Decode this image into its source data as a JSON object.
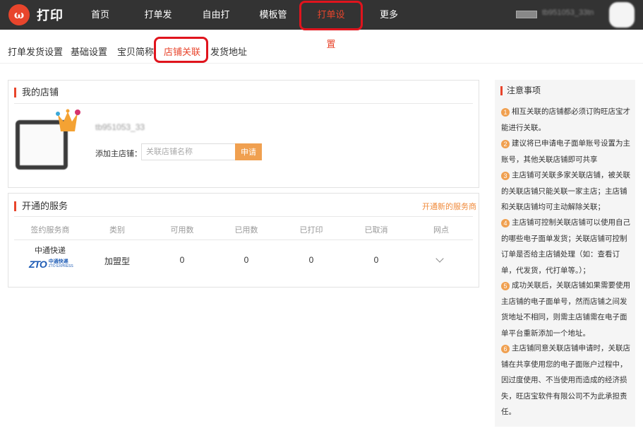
{
  "app": {
    "logo_glyph": "ω",
    "logo_text": "打印"
  },
  "topnav": {
    "items": [
      {
        "label": "首页"
      },
      {
        "label": "打单发货"
      },
      {
        "label": "自由打印"
      },
      {
        "label": "模板管理"
      },
      {
        "label": "打单设置"
      },
      {
        "label": "更多"
      }
    ],
    "active_index": 4,
    "user_name": "tb951053_33tn"
  },
  "subnav": {
    "items": [
      {
        "label": "打单发货设置"
      },
      {
        "label": "基础设置"
      },
      {
        "label": "宝贝简称"
      },
      {
        "label": "店铺关联"
      },
      {
        "label": "发货地址"
      }
    ],
    "active_index": 3
  },
  "my_shop": {
    "title": "我的店铺",
    "shop_id": "tb951053_33",
    "add_label": "添加主店铺：",
    "input_placeholder": "关联店铺名称",
    "apply_button": "申请"
  },
  "services": {
    "title": "开通的服务",
    "open_link": "开通新的服务商",
    "columns": [
      "签约服务商",
      "类别",
      "可用数",
      "已用数",
      "已打印",
      "已取消",
      "网点"
    ],
    "rows": [
      {
        "provider": "中通快递",
        "logo_mark": "ZTO",
        "logo_cn": "中通快递",
        "logo_en": "ZTO EXPRESS",
        "type": "加盟型",
        "available": "0",
        "used": "0",
        "printed": "0",
        "cancelled": "0"
      }
    ]
  },
  "notice": {
    "title": "注意事项",
    "items": [
      {
        "num": "1",
        "text": "相互关联的店铺都必须订购旺店宝才能进行关联。"
      },
      {
        "num": "2",
        "text": "建议将已申请电子面单账号设置为主账号，其他关联店铺即可共享"
      },
      {
        "num": "3",
        "text": "主店铺可关联多家关联店铺，被关联的关联店铺只能关联一家主店；主店铺和关联店铺均可主动解除关联；"
      },
      {
        "num": "4",
        "text": "主店铺可控制关联店铺可以使用自己的哪些电子面单发货；关联店铺可控制订单是否给主店铺处理（如：查看订单，代发货，代打单等。）；"
      },
      {
        "num": "5",
        "text": "成功关联后，关联店铺如果需要使用主店铺的电子面单号，然而店铺之间发货地址不相同，则需主店铺需在电子面单平台重新添加一个地址。"
      },
      {
        "num": "6",
        "text": "主店铺同意关联店铺申请时，关联店铺在共享使用您的电子面账户过程中，因过度使用、不当使用而造成的经济损失，旺店宝软件有限公司不为此承担责任。"
      }
    ]
  },
  "colors": {
    "accent": "#e8452c",
    "topbar": "#333333",
    "button": "#f0a050",
    "highlight_box": "#e0141d"
  }
}
